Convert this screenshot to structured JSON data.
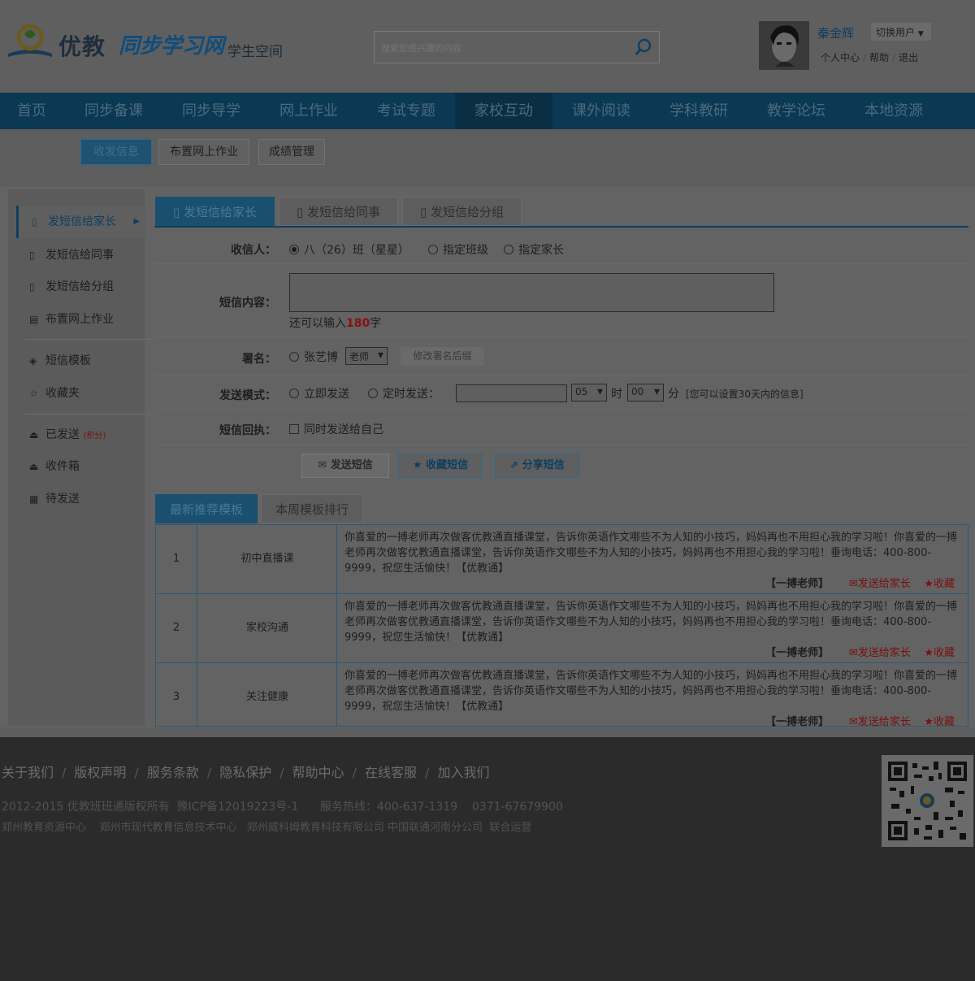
{
  "header": {
    "logo_text": "优教",
    "logo_sync": "同步学习网",
    "space_label": "学生空间",
    "search_placeholder": "搜索您感兴趣的内容",
    "user_name": "秦金辉",
    "switch_user": "切换用户",
    "link_center": "个人中心",
    "link_help": "帮助",
    "link_logout": "退出"
  },
  "nav": {
    "items": [
      "首页",
      "同步备课",
      "同步导学",
      "网上作业",
      "考试专题",
      "家校互动",
      "课外阅读",
      "学科教研",
      "教学论坛",
      "本地资源"
    ],
    "active_index": 5
  },
  "subnav": {
    "items": [
      "收发信息",
      "布置网上作业",
      "成绩管理"
    ]
  },
  "sidebar": {
    "items": [
      "发短信给家长",
      "发短信给同事",
      "发短信给分组",
      "布置网上作业",
      "短信模板",
      "收藏夹",
      "已发送",
      "收件箱",
      "待发送"
    ],
    "sent_badge": "(积分)"
  },
  "tabs": [
    "发短信给家长",
    "发短信给同事",
    "发短信给分组"
  ],
  "form": {
    "recipient_label": "收信人：",
    "recipient_options": [
      "八（26）班（星星）",
      "指定班级",
      "指定家长"
    ],
    "content_label": "短信内容：",
    "remaining_prefix": "还可以输入",
    "remaining_count": "180",
    "remaining_suffix": "字",
    "signature_label": "署名：",
    "signature_name": "张艺博",
    "signature_role": "老师",
    "signature_edit": "修改署名后缀",
    "mode_label": "发送模式：",
    "mode_now": "立即发送",
    "mode_timed": "定时发送：",
    "hour_value": "05",
    "hour_unit": "时",
    "minute_value": "00",
    "minute_unit": "分",
    "schedule_note": "[您可以设置30天内的信息]",
    "receipt_label": "短信回执：",
    "receipt_option": "同时发送给自己",
    "btn_send": "发送短信",
    "btn_fav": "收藏短信",
    "btn_share": "分享短信"
  },
  "templates": {
    "tabs": [
      "最新推荐模板",
      "本周模板排行"
    ],
    "rows": [
      {
        "num": "1",
        "category": "初中直播课",
        "text": "你喜爱的一搏老师再次做客优教通直播课堂，告诉你英语作文哪些不为人知的小技巧，妈妈再也不用担心我的学习啦！你喜爱的一搏老师再次做客优教通直播课堂，告诉你英语作文哪些不为人知的小技巧，妈妈再也不用担心我的学习啦！垂询电话：400-800-9999，祝您生活愉快！【优教通】",
        "author": "【一搏老师】",
        "send": "发送给家长",
        "fav": "收藏"
      },
      {
        "num": "2",
        "category": "家校沟通",
        "text": "你喜爱的一搏老师再次做客优教通直播课堂，告诉你英语作文哪些不为人知的小技巧，妈妈再也不用担心我的学习啦！你喜爱的一搏老师再次做客优教通直播课堂，告诉你英语作文哪些不为人知的小技巧，妈妈再也不用担心我的学习啦！垂询电话：400-800-9999，祝您生活愉快！【优教通】",
        "author": "【一搏老师】",
        "send": "发送给家长",
        "fav": "收藏"
      },
      {
        "num": "3",
        "category": "关注健康",
        "text": "你喜爱的一搏老师再次做客优教通直播课堂，告诉你英语作文哪些不为人知的小技巧，妈妈再也不用担心我的学习啦！你喜爱的一搏老师再次做客优教通直播课堂，告诉你英语作文哪些不为人知的小技巧，妈妈再也不用担心我的学习啦！垂询电话：400-800-9999，祝您生活愉快！【优教通】",
        "author": "【一搏老师】",
        "send": "发送给家长",
        "fav": "收藏"
      }
    ]
  },
  "footer": {
    "links": [
      "关于我们",
      "版权声明",
      "服务条款",
      "隐私保护",
      "帮助中心",
      "在线客服",
      "加入我们"
    ],
    "copyright": "2012-2015 优教班班通版权所有  豫ICP备12019223号-1      服务热线：400-637-1319    0371-67679900",
    "operators": "郑州教育资源中心    郑州市现代教育信息技术中心   郑州威科姆教育科技有限公司 中国联通河南分公司  联合运营"
  },
  "colors": {
    "nav_bg": "#0b3853",
    "accent": "#0f3f60",
    "highlight_red": "#8a1010"
  }
}
